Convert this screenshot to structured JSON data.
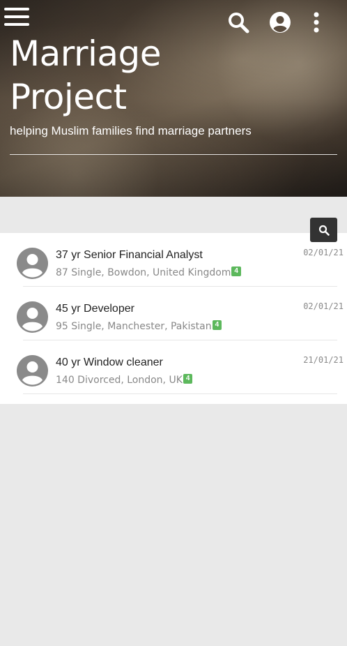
{
  "hero": {
    "title_line1": "Marriage",
    "title_line2": "Project",
    "subtitle": "helping Muslim families find marriage partners"
  },
  "toolbar": {
    "menu_icon": "hamburger-menu-icon",
    "search_icon": "search-icon",
    "account_icon": "account-circle-icon",
    "more_icon": "more-vertical-icon"
  },
  "search_button_icon": "search-icon",
  "colors": {
    "badge": "#5cb85c",
    "search_button": "#333333",
    "page_background": "#e9e9e9"
  },
  "profiles": [
    {
      "title": "37 yr Senior Financial Analyst",
      "meta": "87 Single, Bowdon, United Kingdom",
      "badge": "4",
      "date": "02/01/21"
    },
    {
      "title": "45 yr Developer",
      "meta": "95 Single, Manchester, Pakistan",
      "badge": "4",
      "date": "02/01/21"
    },
    {
      "title": "40 yr Window cleaner",
      "meta": "140 Divorced, London, UK",
      "badge": "4",
      "date": "21/01/21"
    }
  ]
}
